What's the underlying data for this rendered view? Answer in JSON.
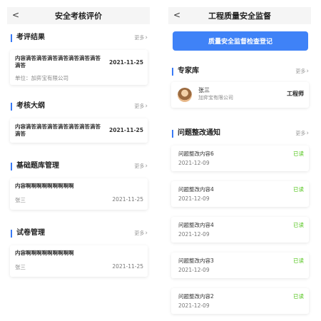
{
  "left": {
    "nav": {
      "back": "<",
      "title": "安全考核评价"
    },
    "more_label": "更多",
    "sections": [
      {
        "title": "考评结果",
        "card": {
          "content": "内容滴答滴答滴答滴答滴答滴答滴答滴答",
          "date": "2021-11-25",
          "unit": "单位：加弈宝有限公司"
        }
      },
      {
        "title": "考核大纲",
        "card": {
          "content": "内容滴答滴答滴答滴答滴答滴答滴答滴答",
          "date": "2021-11-25"
        }
      },
      {
        "title": "基础题库管理",
        "card": {
          "content": "内容啊啊啊啊啊啊啊啊啊",
          "person": "张三",
          "date": "2021-11-25"
        }
      },
      {
        "title": "试卷管理",
        "card": {
          "content": "内容啊啊啊啊啊啊啊啊啊",
          "person": "张三",
          "date": "2021-11-25"
        }
      }
    ]
  },
  "right": {
    "nav": {
      "back": "<",
      "title": "工程质量安全监督"
    },
    "button_label": "质量安全监督检查登记",
    "more_label": "更多",
    "experts": {
      "title": "专家库",
      "items": [
        {
          "name": "张三",
          "org": "加弈宝有限公司",
          "role": "工程师"
        }
      ]
    },
    "notices": {
      "title": "问题整改通知",
      "items": [
        {
          "title": "问题整改内容6",
          "date": "2021-12-09",
          "status": "已读"
        },
        {
          "title": "问题整改内容4",
          "date": "2021-12-09",
          "status": "已读"
        },
        {
          "title": "问题整改内容4",
          "date": "2021-12-09",
          "status": "已读"
        },
        {
          "title": "问题整改内容3",
          "date": "2021-12-09",
          "status": "已读"
        },
        {
          "title": "问题整改内容2",
          "date": "2021-12-09",
          "status": "已读"
        }
      ]
    }
  },
  "colors": {
    "accent": "#3f82f7",
    "read_status": "#52c41a",
    "nav_bg": "#f5f5f5"
  },
  "icons": {
    "back": "chevron-left-icon",
    "more": "chevron-right-icon",
    "avatar": "avatar"
  }
}
